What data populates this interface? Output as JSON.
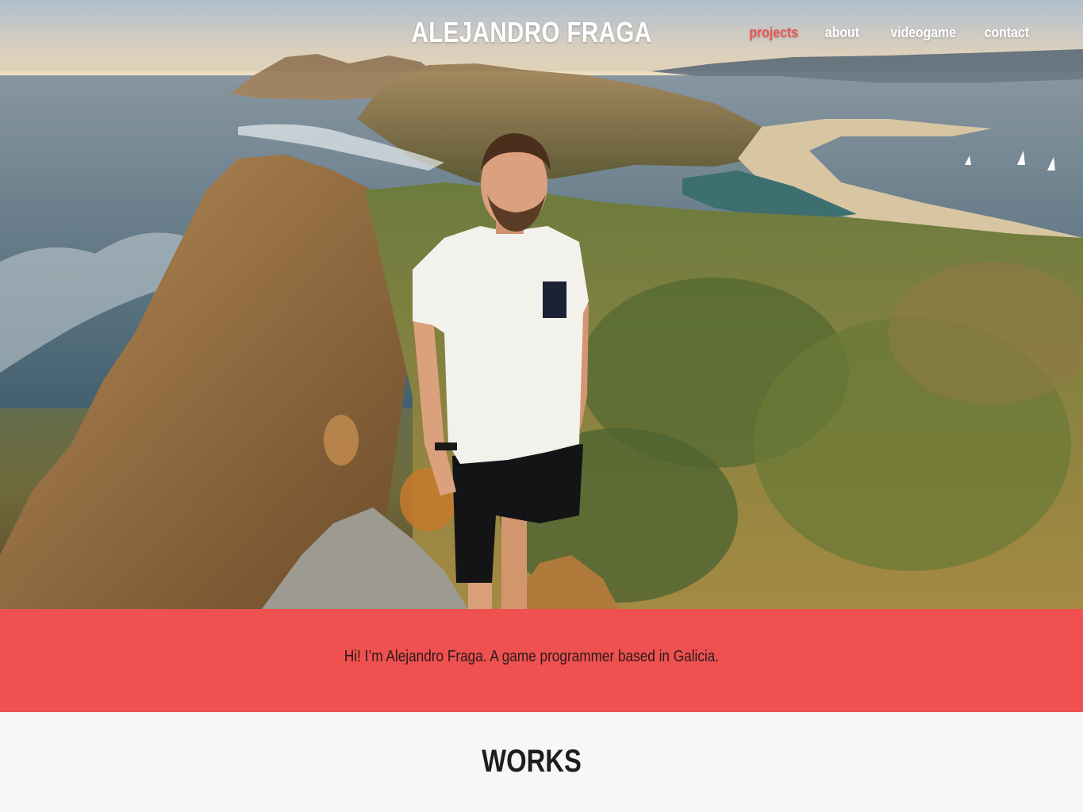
{
  "header": {
    "site_title": "ALEJANDRO FRAGA",
    "nav": [
      {
        "label": "projects",
        "active": true
      },
      {
        "label": "about",
        "active": false
      },
      {
        "label": "videogame",
        "active": false
      },
      {
        "label": "contact",
        "active": false
      }
    ]
  },
  "intro": {
    "text": "Hi! I’m Alejandro Fraga. A game programmer based in Galicia."
  },
  "works": {
    "heading": "WORKS"
  },
  "colors": {
    "accent": "#ee5150",
    "nav_active": "#ee5353",
    "text_light": "#ffffff",
    "text_dark": "#1d1d1d"
  }
}
